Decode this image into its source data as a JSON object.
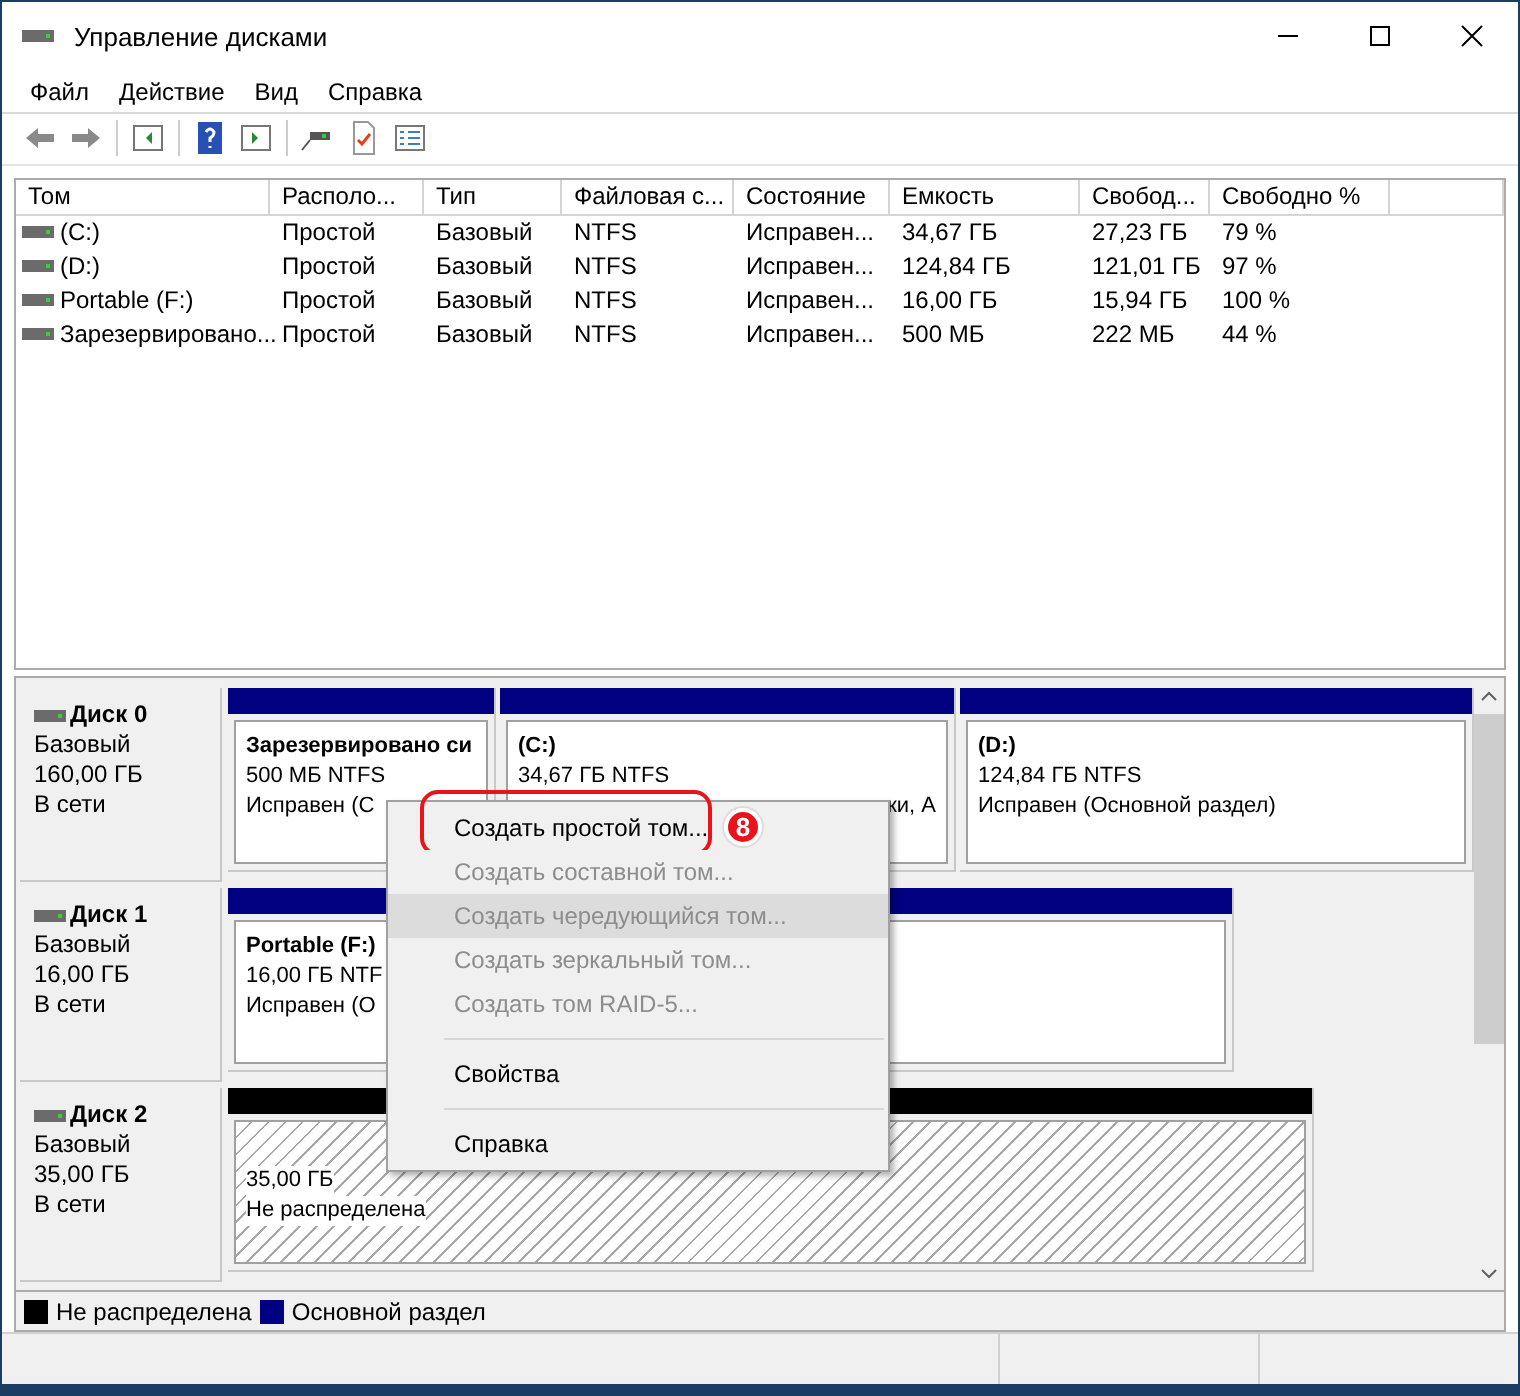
{
  "window": {
    "title": "Управление дисками"
  },
  "menu_bar": [
    "Файл",
    "Действие",
    "Вид",
    "Справка"
  ],
  "volume_table": {
    "columns": [
      "Том",
      "Располо...",
      "Тип",
      "Файловая с...",
      "Состояние",
      "Емкость",
      "Свобод...",
      "Свободно %"
    ],
    "rows": [
      {
        "cells": [
          " (C:)",
          "Простой",
          "Базовый",
          "NTFS",
          "Исправен...",
          "34,67 ГБ",
          "27,23 ГБ",
          "79 %"
        ]
      },
      {
        "cells": [
          " (D:)",
          "Простой",
          "Базовый",
          "NTFS",
          "Исправен...",
          "124,84 ГБ",
          "121,01 ГБ",
          "97 %"
        ]
      },
      {
        "cells": [
          "Portable (F:)",
          "Простой",
          "Базовый",
          "NTFS",
          "Исправен...",
          "16,00 ГБ",
          "15,94 ГБ",
          "100 %"
        ]
      },
      {
        "cells": [
          "Зарезервировано...",
          "Простой",
          "Базовый",
          "NTFS",
          "Исправен...",
          "500 МБ",
          "222 МБ",
          "44 %"
        ]
      }
    ]
  },
  "disks": [
    {
      "name": "Диск 0",
      "type": "Базовый",
      "size": "160,00 ГБ",
      "status": "В сети",
      "partitions": [
        {
          "kind": "primary",
          "name": "Зарезервировано си",
          "size_fs": "500 МБ NTFS",
          "status": "Исправен (С"
        },
        {
          "kind": "primary",
          "name": " (C:)",
          "size_fs": "34,67 ГБ NTFS",
          "status": "ки, А"
        },
        {
          "kind": "primary",
          "name": " (D:)",
          "size_fs": "124,84 ГБ NTFS",
          "status": "Исправен (Основной раздел)"
        }
      ]
    },
    {
      "name": "Диск 1",
      "type": "Базовый",
      "size": "16,00 ГБ",
      "status": "В сети",
      "partitions": [
        {
          "kind": "primary",
          "name": "Portable  (F:)",
          "size_fs": "16,00 ГБ NTF",
          "status": "Исправен (О"
        }
      ]
    },
    {
      "name": "Диск 2",
      "type": "Базовый",
      "size": "35,00 ГБ",
      "status": "В сети",
      "partitions": [
        {
          "kind": "unallocated",
          "size_fs": "35,00 ГБ",
          "status": "Не распределена"
        }
      ]
    }
  ],
  "context_menu": {
    "items": [
      {
        "kind": "item",
        "label": "Создать простой том...",
        "disabled": false,
        "hovered": false,
        "circled": true
      },
      {
        "kind": "item",
        "label": "Создать составной том...",
        "disabled": true,
        "hovered": false,
        "circled": false
      },
      {
        "kind": "item",
        "label": "Создать чередующийся том...",
        "disabled": true,
        "hovered": true,
        "circled": false
      },
      {
        "kind": "item",
        "label": "Создать зеркальный том...",
        "disabled": true,
        "hovered": false,
        "circled": false
      },
      {
        "kind": "item",
        "label": "Создать том RAID-5...",
        "disabled": true,
        "hovered": false,
        "circled": false
      },
      {
        "kind": "separator"
      },
      {
        "kind": "item",
        "label": "Свойства",
        "disabled": false,
        "hovered": false,
        "circled": false
      },
      {
        "kind": "separator"
      },
      {
        "kind": "item",
        "label": "Справка",
        "disabled": false,
        "hovered": false,
        "circled": false
      }
    ],
    "badge": "8"
  },
  "legend": [
    {
      "label": "Не распределена",
      "color": "#000000"
    },
    {
      "label": "Основной раздел",
      "color": "#000080"
    }
  ]
}
